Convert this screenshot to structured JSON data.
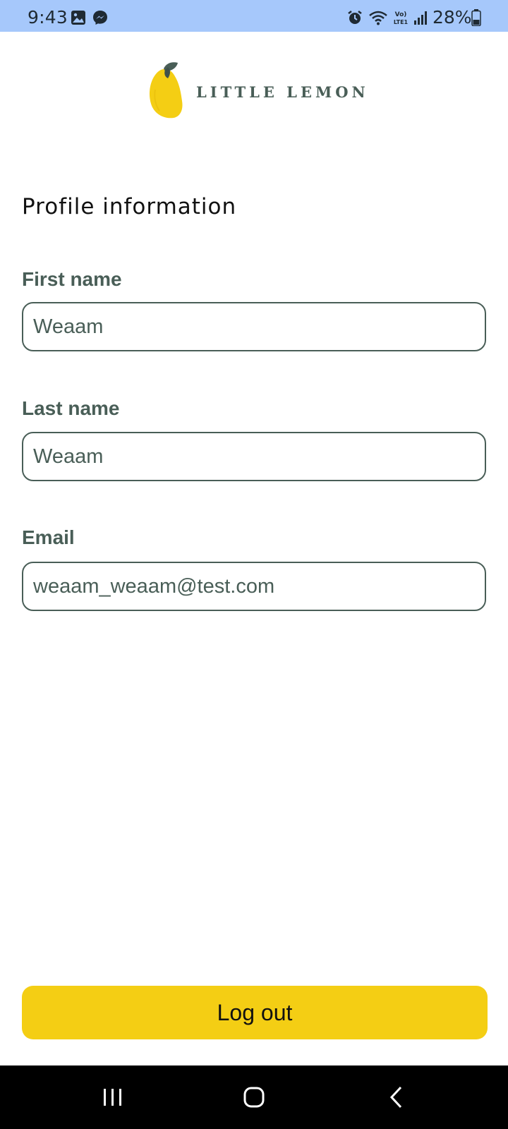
{
  "status_bar": {
    "time": "9:43",
    "battery": "28%",
    "icons": [
      "gallery-icon",
      "messenger-icon",
      "alarm-icon",
      "wifi-icon",
      "volte-icon",
      "signal-icon",
      "battery-icon"
    ]
  },
  "header": {
    "brand": "LITTLE LEMON",
    "colors": {
      "lemon": "#f4ce14",
      "leaf": "#495e57"
    }
  },
  "profile": {
    "title": "Profile information",
    "fields": {
      "first_name": {
        "label": "First name",
        "value": "Weaam"
      },
      "last_name": {
        "label": "Last name",
        "value": "Weaam"
      },
      "email": {
        "label": "Email",
        "value": "weaam_weaam@test.com"
      }
    }
  },
  "actions": {
    "logout_label": "Log out"
  },
  "navigation": {
    "icons": [
      "recents-icon",
      "home-icon",
      "back-icon"
    ]
  },
  "colors": {
    "status_bar": "#a6c8fb",
    "accent": "#f4ce14",
    "text_secondary": "#495e57"
  }
}
